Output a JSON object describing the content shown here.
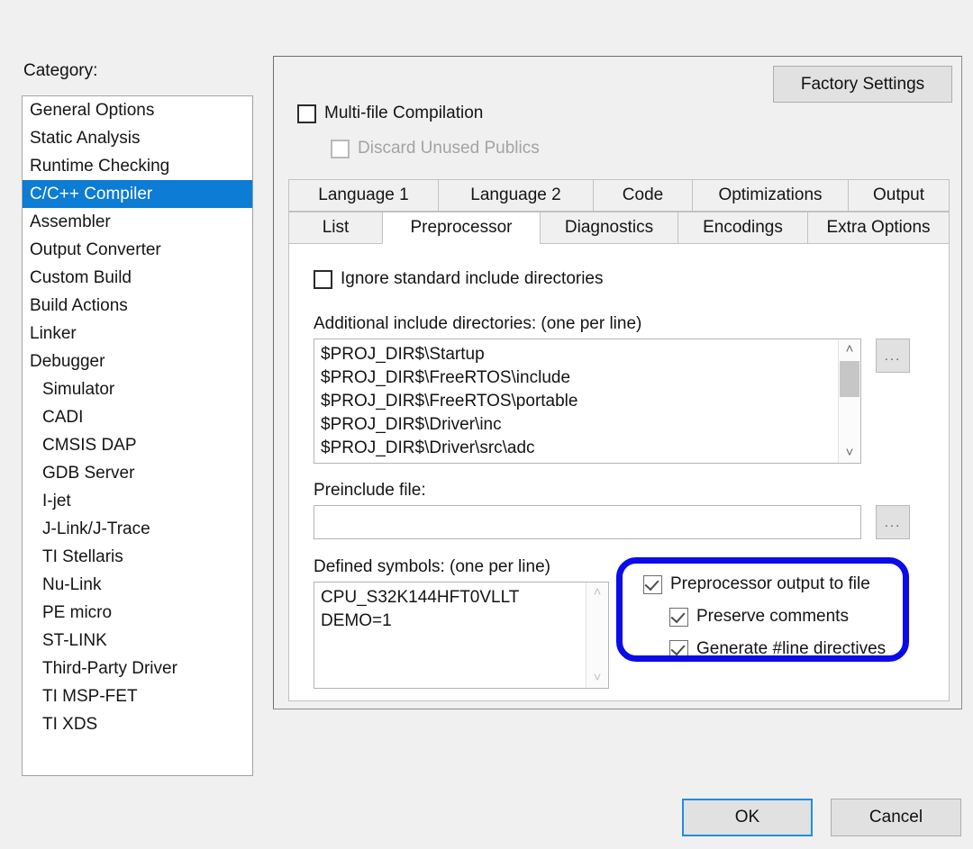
{
  "category": {
    "label": "Category:",
    "items": [
      {
        "label": "General Options",
        "indent": false,
        "selected": false
      },
      {
        "label": "Static Analysis",
        "indent": false,
        "selected": false
      },
      {
        "label": "Runtime Checking",
        "indent": false,
        "selected": false
      },
      {
        "label": "C/C++ Compiler",
        "indent": false,
        "selected": true
      },
      {
        "label": "Assembler",
        "indent": false,
        "selected": false
      },
      {
        "label": "Output Converter",
        "indent": false,
        "selected": false
      },
      {
        "label": "Custom Build",
        "indent": false,
        "selected": false
      },
      {
        "label": "Build Actions",
        "indent": false,
        "selected": false
      },
      {
        "label": "Linker",
        "indent": false,
        "selected": false
      },
      {
        "label": "Debugger",
        "indent": false,
        "selected": false
      },
      {
        "label": "Simulator",
        "indent": true,
        "selected": false
      },
      {
        "label": "CADI",
        "indent": true,
        "selected": false
      },
      {
        "label": "CMSIS DAP",
        "indent": true,
        "selected": false
      },
      {
        "label": "GDB Server",
        "indent": true,
        "selected": false
      },
      {
        "label": "I-jet",
        "indent": true,
        "selected": false
      },
      {
        "label": "J-Link/J-Trace",
        "indent": true,
        "selected": false
      },
      {
        "label": "TI Stellaris",
        "indent": true,
        "selected": false
      },
      {
        "label": "Nu-Link",
        "indent": true,
        "selected": false
      },
      {
        "label": "PE micro",
        "indent": true,
        "selected": false
      },
      {
        "label": "ST-LINK",
        "indent": true,
        "selected": false
      },
      {
        "label": "Third-Party Driver",
        "indent": true,
        "selected": false
      },
      {
        "label": "TI MSP-FET",
        "indent": true,
        "selected": false
      },
      {
        "label": "TI XDS",
        "indent": true,
        "selected": false
      }
    ]
  },
  "panel": {
    "factory_settings_label": "Factory Settings",
    "multifile_compilation": {
      "label": "Multi-file Compilation",
      "checked": false
    },
    "discard_unused_publics": {
      "label": "Discard Unused Publics",
      "checked": false,
      "disabled": true
    }
  },
  "tabs": {
    "row1": [
      "Language 1",
      "Language 2",
      "Code",
      "Optimizations",
      "Output"
    ],
    "row2": [
      "List",
      "Preprocessor",
      "Diagnostics",
      "Encodings",
      "Extra Options"
    ],
    "active": "Preprocessor"
  },
  "preprocessor": {
    "ignore_standard_includes": {
      "label": "Ignore standard include directories",
      "checked": false
    },
    "additional_includes_label": "Additional include directories: (one per line)",
    "additional_includes_value": "$PROJ_DIR$\\Startup\n$PROJ_DIR$\\FreeRTOS\\include\n$PROJ_DIR$\\FreeRTOS\\portable\n$PROJ_DIR$\\Driver\\inc\n$PROJ_DIR$\\Driver\\src\\adc",
    "includes_browse_label": "...",
    "preinclude_label": "Preinclude file:",
    "preinclude_value": "",
    "preinclude_browse_label": "...",
    "defined_symbols_label": "Defined symbols: (one per line)",
    "defined_symbols_value": "CPU_S32K144HFT0VLLT\nDEMO=1",
    "output_options": [
      {
        "label": "Preprocessor output to file",
        "checked": true,
        "indent": false
      },
      {
        "label": "Preserve comments",
        "checked": true,
        "indent": true
      },
      {
        "label": "Generate #line directives",
        "checked": true,
        "indent": true
      }
    ]
  },
  "dialog_buttons": {
    "ok": "OK",
    "cancel": "Cancel"
  },
  "annotation": {
    "shape": "rounded-rectangle-highlight",
    "color": "#0b0bea"
  },
  "icons": {
    "scroll_up": "˄",
    "scroll_down": "˅"
  }
}
